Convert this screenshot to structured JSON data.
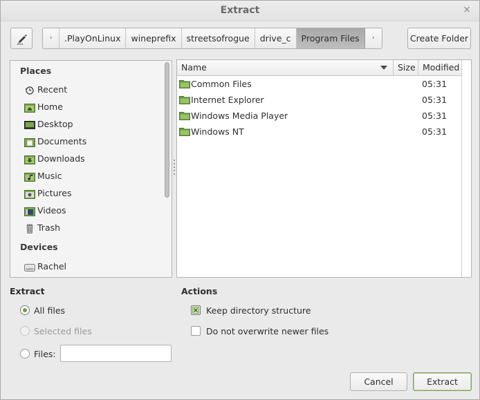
{
  "window": {
    "title": "Extract",
    "close_glyph": "×"
  },
  "toolbar": {
    "edit_icon": "pencil-icon",
    "nav_left": "‹",
    "nav_right": "›",
    "breadcrumbs": [
      ".PlayOnLinux",
      "wineprefix",
      "streetsofrogue",
      "drive_c",
      "Program Files"
    ],
    "active_crumb": "Program Files",
    "create_folder_label": "Create Folder"
  },
  "sidebar": {
    "places_title": "Places",
    "places": [
      {
        "label": "Recent",
        "icon": "recent-icon"
      },
      {
        "label": "Home",
        "icon": "home-folder-icon"
      },
      {
        "label": "Desktop",
        "icon": "desktop-icon"
      },
      {
        "label": "Documents",
        "icon": "documents-folder-icon"
      },
      {
        "label": "Downloads",
        "icon": "downloads-folder-icon"
      },
      {
        "label": "Music",
        "icon": "music-folder-icon"
      },
      {
        "label": "Pictures",
        "icon": "pictures-folder-icon"
      },
      {
        "label": "Videos",
        "icon": "videos-folder-icon"
      },
      {
        "label": "Trash",
        "icon": "trash-icon"
      }
    ],
    "devices_title": "Devices",
    "devices": [
      {
        "label": "Rachel",
        "icon": "drive-icon"
      }
    ]
  },
  "file_list": {
    "columns": {
      "name": "Name",
      "size": "Size",
      "modified": "Modified"
    },
    "sort_column": "Name",
    "rows": [
      {
        "name": "Common Files",
        "size": "",
        "modified": "05:31"
      },
      {
        "name": "Internet Explorer",
        "size": "",
        "modified": "05:31"
      },
      {
        "name": "Windows Media Player",
        "size": "",
        "modified": "05:31"
      },
      {
        "name": "Windows NT",
        "size": "",
        "modified": "05:31"
      }
    ]
  },
  "extract_options": {
    "title": "Extract",
    "all_files": "All files",
    "selected_files": "Selected files",
    "files": "Files:",
    "files_value": "",
    "selected": "All files"
  },
  "actions": {
    "title": "Actions",
    "keep_structure": "Keep directory structure",
    "keep_structure_checked": true,
    "no_overwrite": "Do not overwrite newer files",
    "no_overwrite_checked": false
  },
  "buttons": {
    "cancel": "Cancel",
    "extract": "Extract"
  },
  "colors": {
    "accent": "#6e9a3e",
    "folder": "#8cbe5a",
    "active_crumb": "#b0b0b0"
  }
}
